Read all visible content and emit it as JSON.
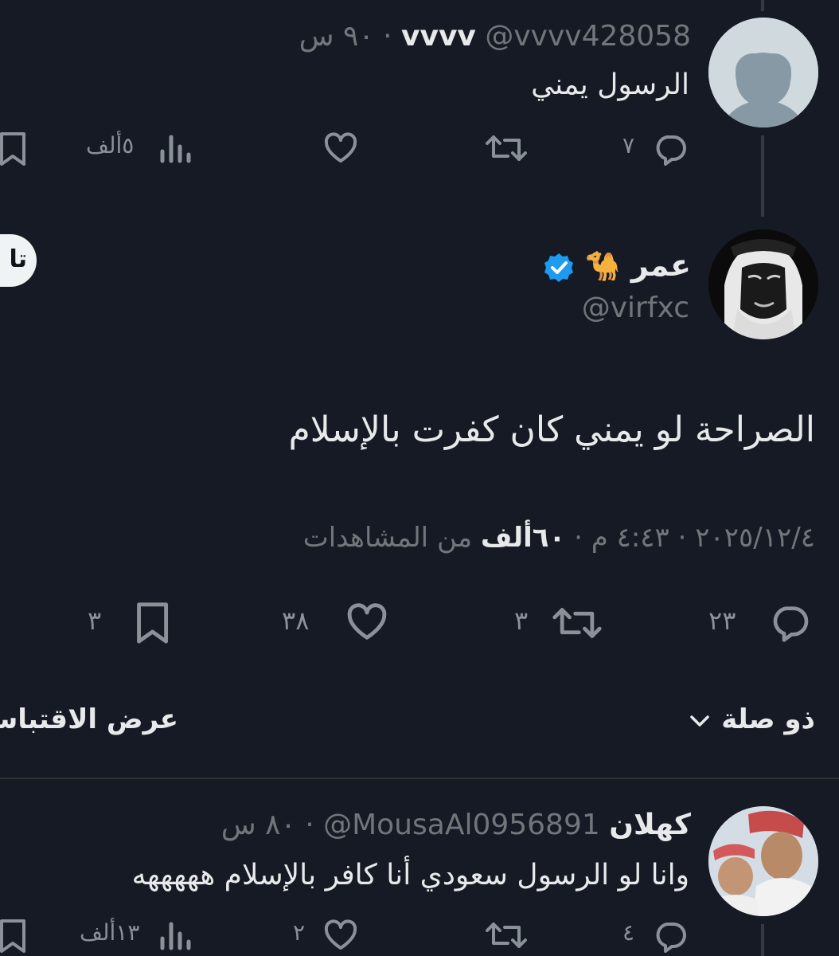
{
  "reply_top": {
    "name": "vvvv",
    "handle": "@vvvv428058",
    "time": "· ٩٠ س",
    "text": "الرسول يمني",
    "replies": "٧",
    "views": "٥ألف"
  },
  "main_tweet": {
    "name": "عمر",
    "emoji": "🐪",
    "handle": "@virfxc",
    "text": "الصراحة لو يمني كان كفرت بالإسلام",
    "date_time": "٢٠٢٥/١٢/٤ · ٤:٤٣ م · ",
    "views_count": "٦٠ألف",
    "views_label": " من المشاهدات",
    "replies": "٢٣",
    "retweets": "٣",
    "likes": "٣٨",
    "bookmarks": "٣",
    "follow_label": "تا"
  },
  "filters": {
    "relevant_label": "ذو صلة",
    "quotes_label": "عرض الاقتباسا"
  },
  "reply_bottom": {
    "name": "كهلان",
    "handle": "@MousaAl0956891",
    "time": "· ٨٠ س",
    "text": "وانا لو الرسول سعودي أنا كافر بالإسلام هههههه",
    "replies": "٤",
    "likes": "٢",
    "views": "١٣ألف"
  },
  "colors": {
    "background": "#161a24",
    "text": "#e7e9ea",
    "dim": "#71767b",
    "verified": "#1d9bf0"
  }
}
